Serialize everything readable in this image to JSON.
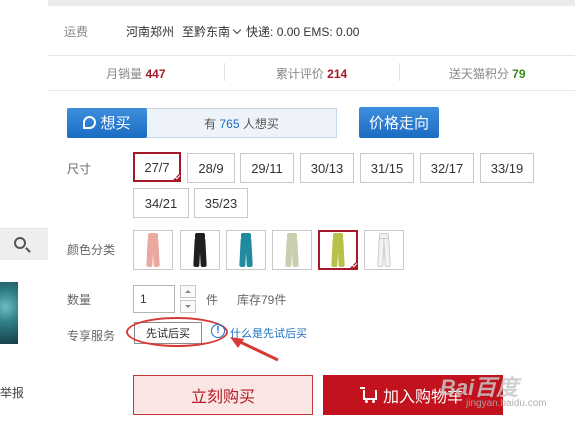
{
  "sidebar": {
    "report_label": "举报"
  },
  "shipping": {
    "label": "运费",
    "from": "河南郑州",
    "to": "至黔东南",
    "fees": "快递: 0.00 EMS: 0.00"
  },
  "stats": [
    {
      "label": "月销量",
      "value": "447",
      "color": "#a5192a"
    },
    {
      "label": "累计评价",
      "value": "214",
      "color": "#a5192a"
    },
    {
      "label": "送天猫积分",
      "value": "79",
      "color": "#3a8a16"
    }
  ],
  "want": {
    "button_label": "想买",
    "prefix": "有",
    "count": "765",
    "suffix": "人想买"
  },
  "price_trend_label": "价格走向",
  "size": {
    "label": "尺寸",
    "options": [
      "27/7",
      "28/9",
      "29/11",
      "30/13",
      "31/15",
      "32/17",
      "33/19",
      "34/21",
      "35/23"
    ],
    "selected": "27/7"
  },
  "color": {
    "label": "颜色分类",
    "swatches": [
      "#e9a9a0",
      "#1e1e1e",
      "#1f8aa0",
      "#c7cfb0",
      "#b8c04a",
      "#f2f2f2"
    ],
    "selected_index": 4
  },
  "quantity": {
    "label": "数量",
    "value": "1",
    "unit": "件",
    "stock": "库存79件"
  },
  "service": {
    "label": "专享服务",
    "button_label": "先试后买",
    "info_icon_text": "!",
    "link_text": "什么是先试后买"
  },
  "actions": {
    "buy_label": "立刻购买",
    "cart_label": "加入购物车"
  },
  "annotation_color": "#d73a35",
  "watermark": {
    "brand": "Bai百度",
    "sub": "jingyan.baidu.com"
  }
}
